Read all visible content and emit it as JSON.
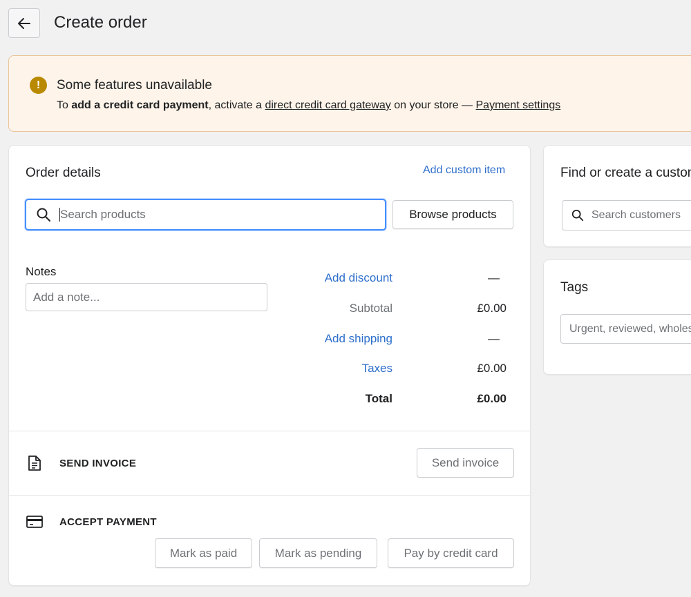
{
  "header": {
    "title": "Create order"
  },
  "banner": {
    "title": "Some features unavailable",
    "text_prefix": "To ",
    "text_bold": "add a credit card payment",
    "text_mid": ", activate a ",
    "link_gateway": "direct credit card gateway",
    "text_after": " on your store — ",
    "link_settings": "Payment settings",
    "color": "#fff4ea"
  },
  "order": {
    "heading": "Order details",
    "add_custom_item": "Add custom item",
    "search_placeholder": "Search products",
    "browse_button": "Browse products",
    "notes_label": "Notes",
    "notes_placeholder": "Add a note...",
    "summary": {
      "discount_label": "Add discount",
      "discount_value": "—",
      "subtotal_label": "Subtotal",
      "subtotal_value": "£0.00",
      "shipping_label": "Add shipping",
      "shipping_value": "—",
      "taxes_label": "Taxes",
      "taxes_value": "£0.00",
      "total_label": "Total",
      "total_value": "£0.00"
    }
  },
  "send_invoice": {
    "title": "SEND INVOICE",
    "button": "Send invoice"
  },
  "accept_payment": {
    "title": "ACCEPT PAYMENT",
    "mark_paid": "Mark as paid",
    "mark_pending": "Mark as pending",
    "pay_card": "Pay by credit card"
  },
  "customer": {
    "heading": "Find or create a customer",
    "search_placeholder": "Search customers"
  },
  "tags": {
    "heading": "Tags",
    "placeholder": "Urgent, reviewed, wholesale"
  },
  "colors": {
    "accent_link": "#2c6ecb",
    "focus_border": "#458fff",
    "warning": "#b98900"
  }
}
